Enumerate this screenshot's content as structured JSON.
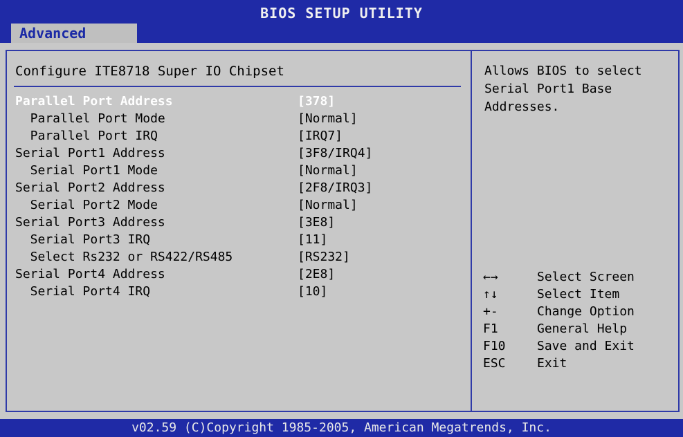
{
  "title": "BIOS SETUP UTILITY",
  "active_tab": "Advanced",
  "section_title": "Configure ITE8718 Super IO Chipset",
  "settings": [
    {
      "label": "Parallel Port Address",
      "value": "[378]"
    },
    {
      "label": "  Parallel Port Mode",
      "value": "[Normal]"
    },
    {
      "label": "  Parallel Port IRQ",
      "value": "[IRQ7]"
    },
    {
      "label": "Serial Port1 Address",
      "value": "[3F8/IRQ4]"
    },
    {
      "label": "  Serial Port1 Mode",
      "value": "[Normal]"
    },
    {
      "label": "Serial Port2 Address",
      "value": "[2F8/IRQ3]"
    },
    {
      "label": "  Serial Port2 Mode",
      "value": "[Normal]"
    },
    {
      "label": "Serial Port3 Address",
      "value": "[3E8]"
    },
    {
      "label": "  Serial Port3 IRQ",
      "value": "[11]"
    },
    {
      "label": "  Select Rs232 or RS422/RS485",
      "value": "[RS232]"
    },
    {
      "label": "Serial Port4 Address",
      "value": "[2E8]"
    },
    {
      "label": "  Serial Port4 IRQ",
      "value": "[10]"
    }
  ],
  "help": {
    "text": "Allows BIOS to select Serial Port1 Base Addresses."
  },
  "keys": [
    {
      "key": "←→",
      "action": "Select Screen"
    },
    {
      "key": "↑↓",
      "action": "Select Item"
    },
    {
      "key": "+-",
      "action": "Change Option"
    },
    {
      "key": "F1",
      "action": "General Help"
    },
    {
      "key": "F10",
      "action": "Save and Exit"
    },
    {
      "key": "ESC",
      "action": "Exit"
    }
  ],
  "footer": "v02.59 (C)Copyright 1985-2005, American Megatrends, Inc.",
  "colors": {
    "bar": "#1f2aa6",
    "background": "#c8c8c8",
    "selected_text": "#ffffff"
  }
}
